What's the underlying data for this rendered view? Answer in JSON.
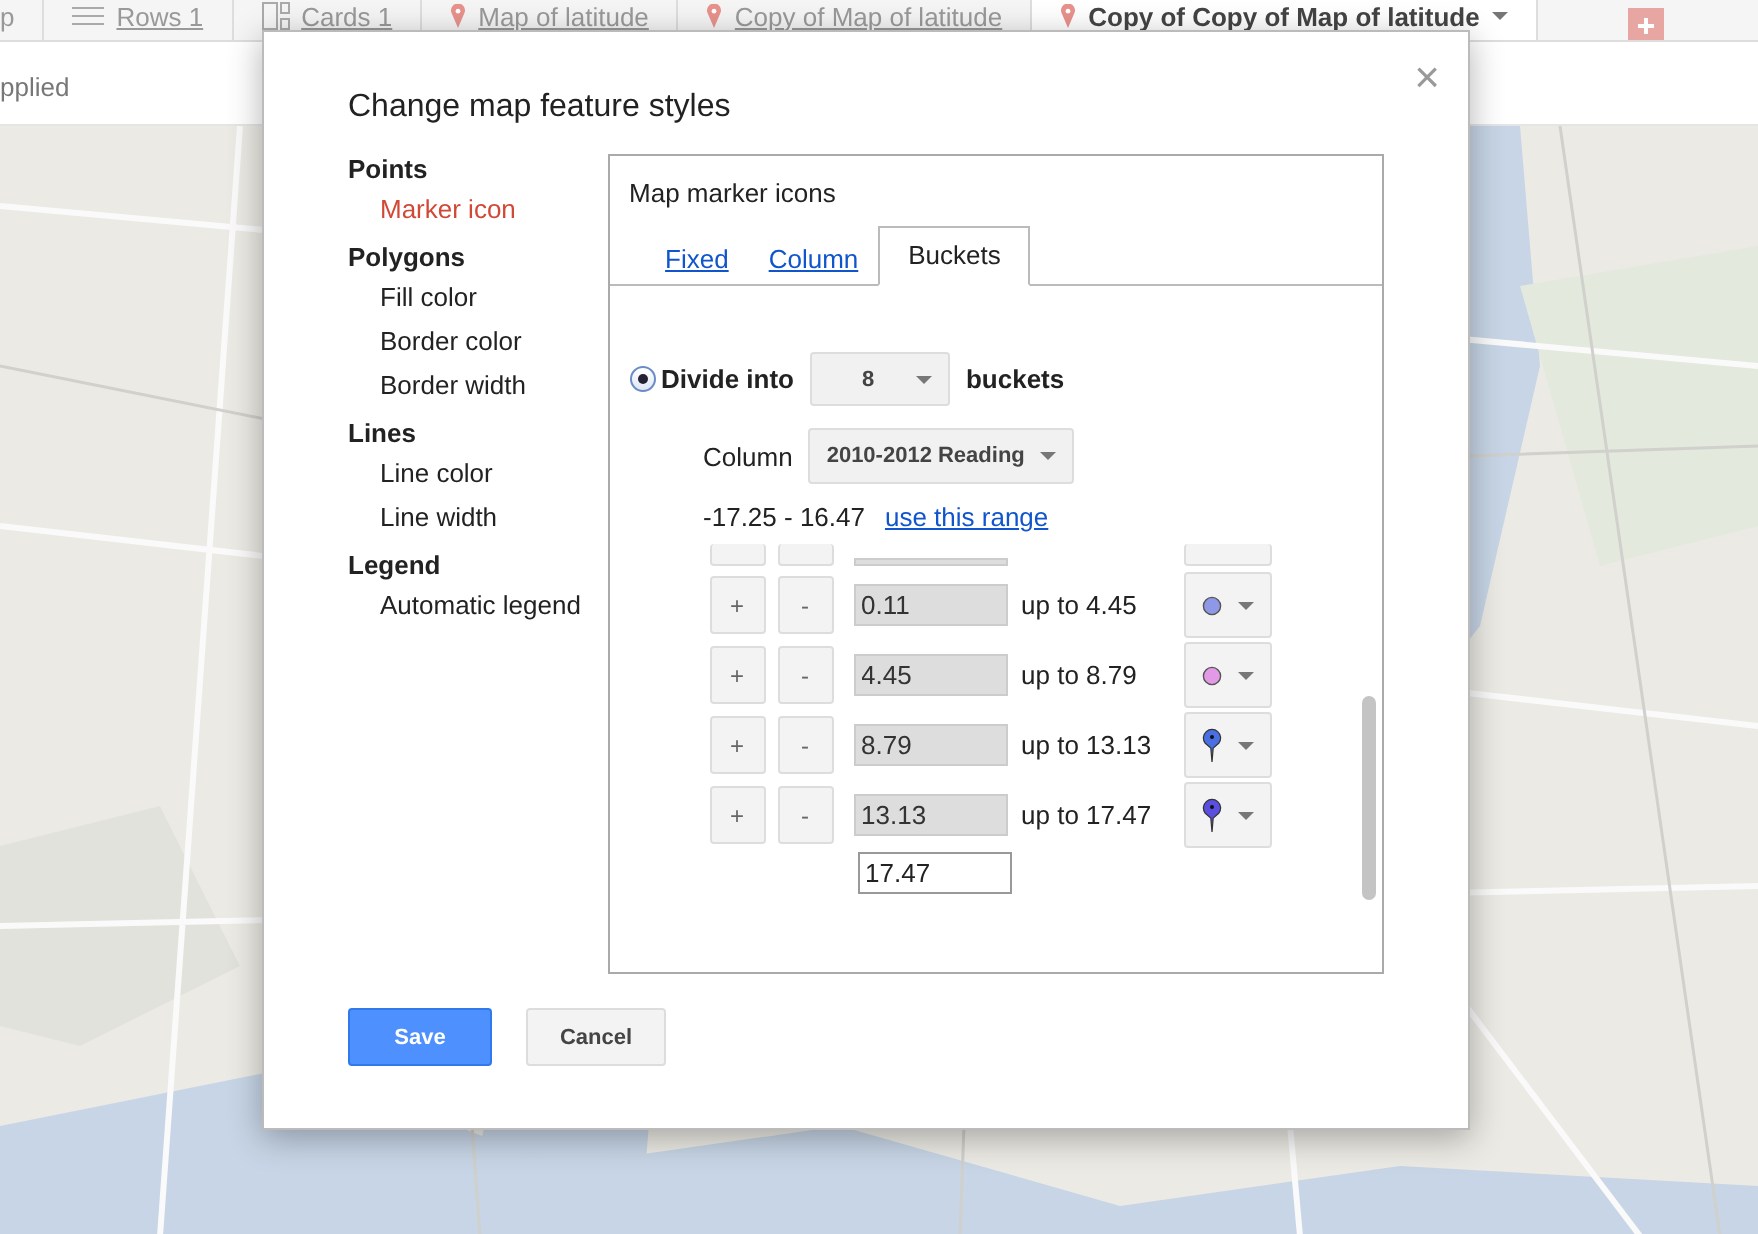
{
  "tabs": [
    {
      "label": "p",
      "kind": "plain",
      "selected": false
    },
    {
      "label": "Rows 1",
      "kind": "rows",
      "selected": false
    },
    {
      "label": "Cards 1",
      "kind": "cards",
      "selected": false
    },
    {
      "label": "Map of latitude",
      "kind": "map",
      "selected": false
    },
    {
      "label": "Copy of Map of latitude",
      "kind": "map",
      "selected": false
    },
    {
      "label": "Copy of Copy of Map of latitude",
      "kind": "map",
      "selected": true
    }
  ],
  "filter_bar": {
    "text": "pplied"
  },
  "dialog": {
    "title": "Change map feature styles",
    "close": "×",
    "nav": [
      {
        "heading": "Points",
        "items": [
          {
            "label": "Marker icon",
            "selected": true
          }
        ]
      },
      {
        "heading": "Polygons",
        "items": [
          {
            "label": "Fill color",
            "selected": false
          },
          {
            "label": "Border color",
            "selected": false
          },
          {
            "label": "Border width",
            "selected": false
          }
        ]
      },
      {
        "heading": "Lines",
        "items": [
          {
            "label": "Line color",
            "selected": false
          },
          {
            "label": "Line width",
            "selected": false
          }
        ]
      },
      {
        "heading": "Legend",
        "items": [
          {
            "label": "Automatic legend",
            "selected": false
          }
        ]
      }
    ],
    "panel": {
      "title": "Map marker icons",
      "tabs": [
        {
          "label": "Fixed",
          "selected": false
        },
        {
          "label": "Column",
          "selected": false
        },
        {
          "label": "Buckets",
          "selected": true
        }
      ],
      "divide": {
        "selected": true,
        "label": "Divide into",
        "count": "8",
        "suffix": "buckets"
      },
      "column": {
        "label": "Column",
        "value": "2010-2012 Reading"
      },
      "range": {
        "text": "-17.25 - 16.47",
        "link": "use this range"
      },
      "buckets": [
        {
          "kind": "partial"
        },
        {
          "kind": "circle",
          "plus": "+",
          "minus": "-",
          "from": "0.11",
          "upto": "up to 4.45",
          "color": "#8e98e6"
        },
        {
          "kind": "circle",
          "plus": "+",
          "minus": "-",
          "from": "4.45",
          "upto": "up to 8.79",
          "color": "#e29ae6"
        },
        {
          "kind": "pin",
          "plus": "+",
          "minus": "-",
          "from": "8.79",
          "upto": "up to 13.13",
          "color": "#4a6fe3"
        },
        {
          "kind": "pin",
          "plus": "+",
          "minus": "-",
          "from": "13.13",
          "upto": "up to 17.47",
          "color": "#5b4fe0"
        }
      ],
      "last": "17.47"
    },
    "buttons": [
      {
        "label": "Save",
        "kind": "primary"
      },
      {
        "label": "Cancel",
        "kind": "secondary"
      }
    ]
  }
}
